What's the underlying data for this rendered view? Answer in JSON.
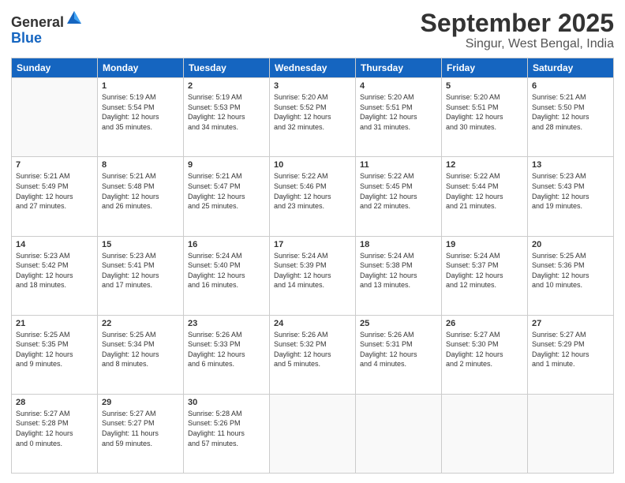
{
  "header": {
    "logo_line1": "General",
    "logo_line2": "Blue",
    "month": "September 2025",
    "location": "Singur, West Bengal, India"
  },
  "weekdays": [
    "Sunday",
    "Monday",
    "Tuesday",
    "Wednesday",
    "Thursday",
    "Friday",
    "Saturday"
  ],
  "weeks": [
    [
      {
        "day": "",
        "info": ""
      },
      {
        "day": "1",
        "info": "Sunrise: 5:19 AM\nSunset: 5:54 PM\nDaylight: 12 hours\nand 35 minutes."
      },
      {
        "day": "2",
        "info": "Sunrise: 5:19 AM\nSunset: 5:53 PM\nDaylight: 12 hours\nand 34 minutes."
      },
      {
        "day": "3",
        "info": "Sunrise: 5:20 AM\nSunset: 5:52 PM\nDaylight: 12 hours\nand 32 minutes."
      },
      {
        "day": "4",
        "info": "Sunrise: 5:20 AM\nSunset: 5:51 PM\nDaylight: 12 hours\nand 31 minutes."
      },
      {
        "day": "5",
        "info": "Sunrise: 5:20 AM\nSunset: 5:51 PM\nDaylight: 12 hours\nand 30 minutes."
      },
      {
        "day": "6",
        "info": "Sunrise: 5:21 AM\nSunset: 5:50 PM\nDaylight: 12 hours\nand 28 minutes."
      }
    ],
    [
      {
        "day": "7",
        "info": "Sunrise: 5:21 AM\nSunset: 5:49 PM\nDaylight: 12 hours\nand 27 minutes."
      },
      {
        "day": "8",
        "info": "Sunrise: 5:21 AM\nSunset: 5:48 PM\nDaylight: 12 hours\nand 26 minutes."
      },
      {
        "day": "9",
        "info": "Sunrise: 5:21 AM\nSunset: 5:47 PM\nDaylight: 12 hours\nand 25 minutes."
      },
      {
        "day": "10",
        "info": "Sunrise: 5:22 AM\nSunset: 5:46 PM\nDaylight: 12 hours\nand 23 minutes."
      },
      {
        "day": "11",
        "info": "Sunrise: 5:22 AM\nSunset: 5:45 PM\nDaylight: 12 hours\nand 22 minutes."
      },
      {
        "day": "12",
        "info": "Sunrise: 5:22 AM\nSunset: 5:44 PM\nDaylight: 12 hours\nand 21 minutes."
      },
      {
        "day": "13",
        "info": "Sunrise: 5:23 AM\nSunset: 5:43 PM\nDaylight: 12 hours\nand 19 minutes."
      }
    ],
    [
      {
        "day": "14",
        "info": "Sunrise: 5:23 AM\nSunset: 5:42 PM\nDaylight: 12 hours\nand 18 minutes."
      },
      {
        "day": "15",
        "info": "Sunrise: 5:23 AM\nSunset: 5:41 PM\nDaylight: 12 hours\nand 17 minutes."
      },
      {
        "day": "16",
        "info": "Sunrise: 5:24 AM\nSunset: 5:40 PM\nDaylight: 12 hours\nand 16 minutes."
      },
      {
        "day": "17",
        "info": "Sunrise: 5:24 AM\nSunset: 5:39 PM\nDaylight: 12 hours\nand 14 minutes."
      },
      {
        "day": "18",
        "info": "Sunrise: 5:24 AM\nSunset: 5:38 PM\nDaylight: 12 hours\nand 13 minutes."
      },
      {
        "day": "19",
        "info": "Sunrise: 5:24 AM\nSunset: 5:37 PM\nDaylight: 12 hours\nand 12 minutes."
      },
      {
        "day": "20",
        "info": "Sunrise: 5:25 AM\nSunset: 5:36 PM\nDaylight: 12 hours\nand 10 minutes."
      }
    ],
    [
      {
        "day": "21",
        "info": "Sunrise: 5:25 AM\nSunset: 5:35 PM\nDaylight: 12 hours\nand 9 minutes."
      },
      {
        "day": "22",
        "info": "Sunrise: 5:25 AM\nSunset: 5:34 PM\nDaylight: 12 hours\nand 8 minutes."
      },
      {
        "day": "23",
        "info": "Sunrise: 5:26 AM\nSunset: 5:33 PM\nDaylight: 12 hours\nand 6 minutes."
      },
      {
        "day": "24",
        "info": "Sunrise: 5:26 AM\nSunset: 5:32 PM\nDaylight: 12 hours\nand 5 minutes."
      },
      {
        "day": "25",
        "info": "Sunrise: 5:26 AM\nSunset: 5:31 PM\nDaylight: 12 hours\nand 4 minutes."
      },
      {
        "day": "26",
        "info": "Sunrise: 5:27 AM\nSunset: 5:30 PM\nDaylight: 12 hours\nand 2 minutes."
      },
      {
        "day": "27",
        "info": "Sunrise: 5:27 AM\nSunset: 5:29 PM\nDaylight: 12 hours\nand 1 minute."
      }
    ],
    [
      {
        "day": "28",
        "info": "Sunrise: 5:27 AM\nSunset: 5:28 PM\nDaylight: 12 hours\nand 0 minutes."
      },
      {
        "day": "29",
        "info": "Sunrise: 5:27 AM\nSunset: 5:27 PM\nDaylight: 11 hours\nand 59 minutes."
      },
      {
        "day": "30",
        "info": "Sunrise: 5:28 AM\nSunset: 5:26 PM\nDaylight: 11 hours\nand 57 minutes."
      },
      {
        "day": "",
        "info": ""
      },
      {
        "day": "",
        "info": ""
      },
      {
        "day": "",
        "info": ""
      },
      {
        "day": "",
        "info": ""
      }
    ]
  ]
}
